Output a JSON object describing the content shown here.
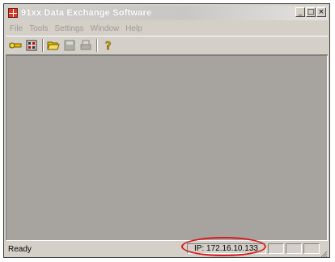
{
  "window": {
    "title": "91xx Data Exchange Software",
    "controls": {
      "minimize": "_",
      "maximize": "□",
      "close": "×"
    }
  },
  "menu": [
    "File",
    "Tools",
    "Settings",
    "Window",
    "Help"
  ],
  "toolbar": {
    "icons": [
      "connect-icon",
      "settings-icon",
      "open-folder-icon",
      "save-icon",
      "print-icon",
      "help-icon"
    ]
  },
  "status": {
    "text": "Ready",
    "ip": "IP: 172.16.10.133"
  },
  "colors": {
    "client_area": "#a7a49f",
    "window_face": "#d4d0c8",
    "highlight_oval": "#d8181e"
  }
}
